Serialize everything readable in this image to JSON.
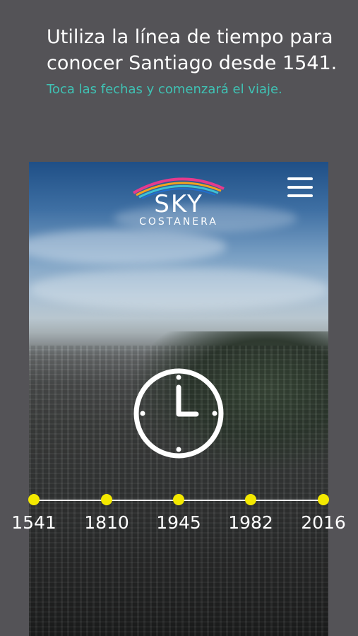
{
  "intro": {
    "title": "Utiliza la línea de tiempo para conocer Santiago desde 1541.",
    "subtitle": "Toca las fechas y comenzará el viaje."
  },
  "logo": {
    "word": "SKY",
    "sub": "COSTANERA",
    "rainbow_colors": [
      "#e63a8c",
      "#f4a21c",
      "#3ec1d3",
      "#1f6fd1"
    ]
  },
  "menu": {
    "icon": "hamburger-menu-icon"
  },
  "clock": {
    "icon": "clock-icon",
    "color": "#ffffff"
  },
  "timeline": {
    "dot_color": "#f4e900",
    "years": [
      "1541",
      "1810",
      "1945",
      "1982",
      "2016"
    ]
  }
}
